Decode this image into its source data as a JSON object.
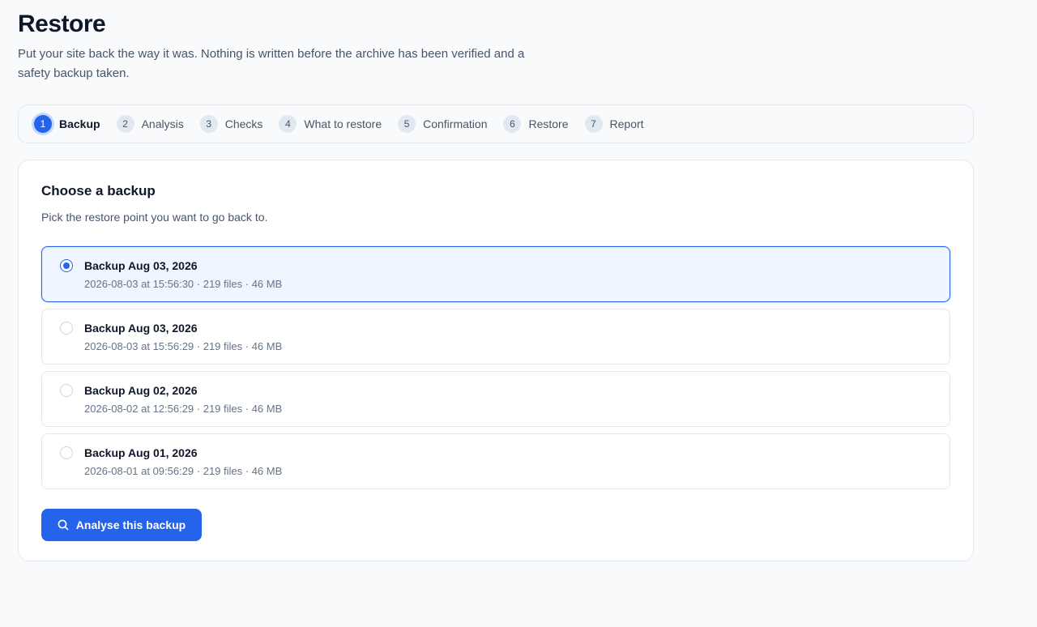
{
  "header": {
    "title": "Restore",
    "subtitle": "Put your site back the way it was. Nothing is written before the archive has been verified and a safety backup taken."
  },
  "steps": [
    {
      "num": "1",
      "label": "Backup",
      "active": true
    },
    {
      "num": "2",
      "label": "Analysis",
      "active": false
    },
    {
      "num": "3",
      "label": "Checks",
      "active": false
    },
    {
      "num": "4",
      "label": "What to restore",
      "active": false
    },
    {
      "num": "5",
      "label": "Confirmation",
      "active": false
    },
    {
      "num": "6",
      "label": "Restore",
      "active": false
    },
    {
      "num": "7",
      "label": "Report",
      "active": false
    }
  ],
  "card": {
    "title": "Choose a backup",
    "description": "Pick the restore point you want to go back to."
  },
  "backups": [
    {
      "name": "Backup Aug 03, 2026",
      "meta": "2026-08-03 at 15:56:30 · 219 files · 46 MB",
      "selected": true
    },
    {
      "name": "Backup Aug 03, 2026",
      "meta": "2026-08-03 at 15:56:29 · 219 files · 46 MB",
      "selected": false
    },
    {
      "name": "Backup Aug 02, 2026",
      "meta": "2026-08-02 at 12:56:29 · 219 files · 46 MB",
      "selected": false
    },
    {
      "name": "Backup Aug 01, 2026",
      "meta": "2026-08-01 at 09:56:29 · 219 files · 46 MB",
      "selected": false
    }
  ],
  "actions": {
    "analyse_label": "Analyse this backup",
    "analyse_icon": "search-icon"
  },
  "colors": {
    "accent": "#2563eb",
    "selected_bg": "#eff6ff",
    "text_primary": "#0f172a",
    "text_secondary": "#475569"
  }
}
